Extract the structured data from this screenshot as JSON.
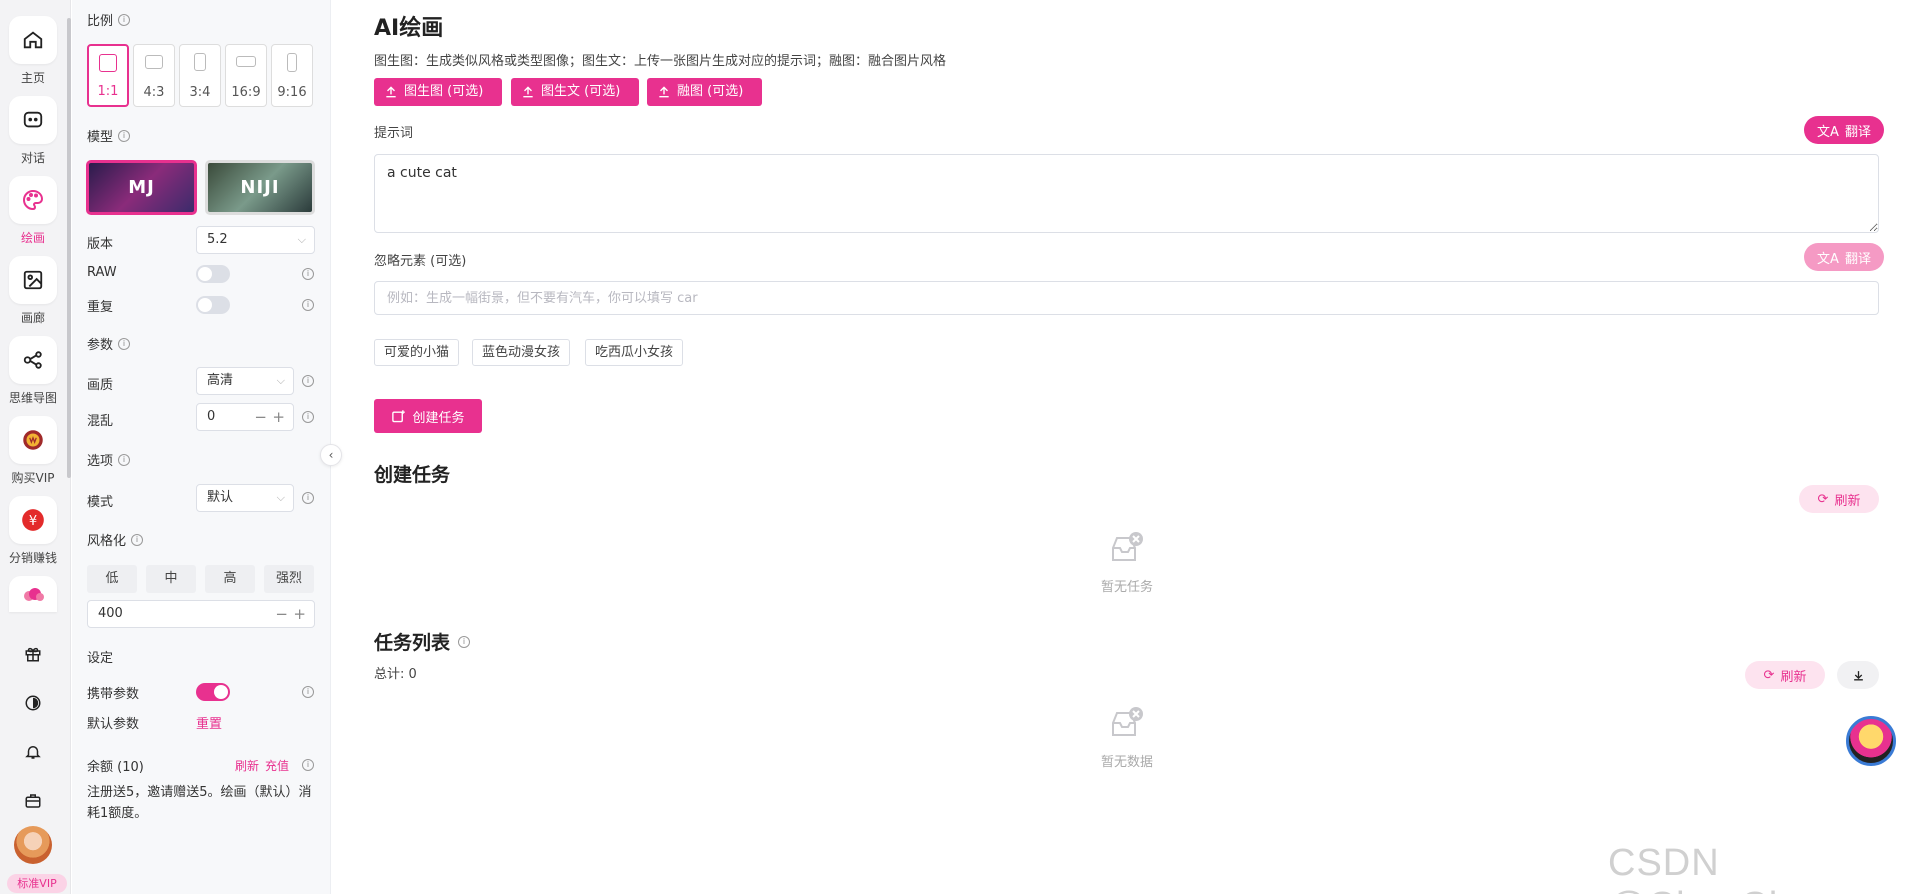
{
  "nav": {
    "items": [
      {
        "label": "主页",
        "icon": "home-icon"
      },
      {
        "label": "对话",
        "icon": "chat-icon"
      },
      {
        "label": "绘画",
        "icon": "palette-icon"
      },
      {
        "label": "画廊",
        "icon": "image-icon"
      },
      {
        "label": "思维导图",
        "icon": "mindmap-icon"
      },
      {
        "label": "购买VIP",
        "icon": "vip-icon"
      },
      {
        "label": "分销赚钱",
        "icon": "yuan-icon"
      }
    ],
    "active": "绘画",
    "vip_badge": "标准VIP",
    "accent": "#e8318f"
  },
  "settings": {
    "ratio_title": "比例",
    "ratios": [
      "1:1",
      "4:3",
      "3:4",
      "16:9",
      "9:16"
    ],
    "selected_ratio": "1:1",
    "model_title": "模型",
    "models": [
      "MJ",
      "NIJI"
    ],
    "selected_model": "MJ",
    "version_label": "版本",
    "version_value": "5.2",
    "raw_label": "RAW",
    "raw_on": false,
    "repeat_label": "重复",
    "repeat_on": false,
    "params_title": "参数",
    "quality_label": "画质",
    "quality_value": "高清",
    "chaos_label": "混乱",
    "chaos_value": "0",
    "options_title": "选项",
    "mode_label": "模式",
    "mode_value": "默认",
    "stylize_title": "风格化",
    "stylize_options": [
      "低",
      "中",
      "高",
      "强烈"
    ],
    "stylize_value": "400",
    "config_title": "设定",
    "carry_params_label": "携带参数",
    "carry_params_on": true,
    "default_params_label": "默认参数",
    "reset_label": "重置",
    "balance_label": "余额 (10)",
    "refresh_link": "刷新",
    "recharge_link": "充值",
    "note": "注册送5，邀请赠送5。绘画（默认）消耗1额度。"
  },
  "main": {
    "title": "AI绘画",
    "subtitle": "图生图：生成类似风格或类型图像；图生文：上传一张图片生成对应的提示词；融图：融合图片风格",
    "upload_buttons": [
      "图生图 (可选)",
      "图生文 (可选)",
      "融图 (可选)"
    ],
    "prompt_label": "提示词",
    "translate_label": "翻译",
    "prompt_value": "a cute cat",
    "negative_label": "忽略元素 (可选)",
    "negative_placeholder": "例如：生成一幅街景，但不要有汽车，你可以填写 car",
    "chips": [
      "可爱的小猫",
      "蓝色动漫女孩",
      "吃西瓜小女孩"
    ],
    "create_button": "创建任务",
    "tasks_title": "创建任务",
    "refresh_label": "刷新",
    "no_tasks": "暂无任务",
    "list_title": "任务列表",
    "total": "总计: 0",
    "no_data": "暂无数据"
  },
  "watermark": "CSDN @ChayChan"
}
